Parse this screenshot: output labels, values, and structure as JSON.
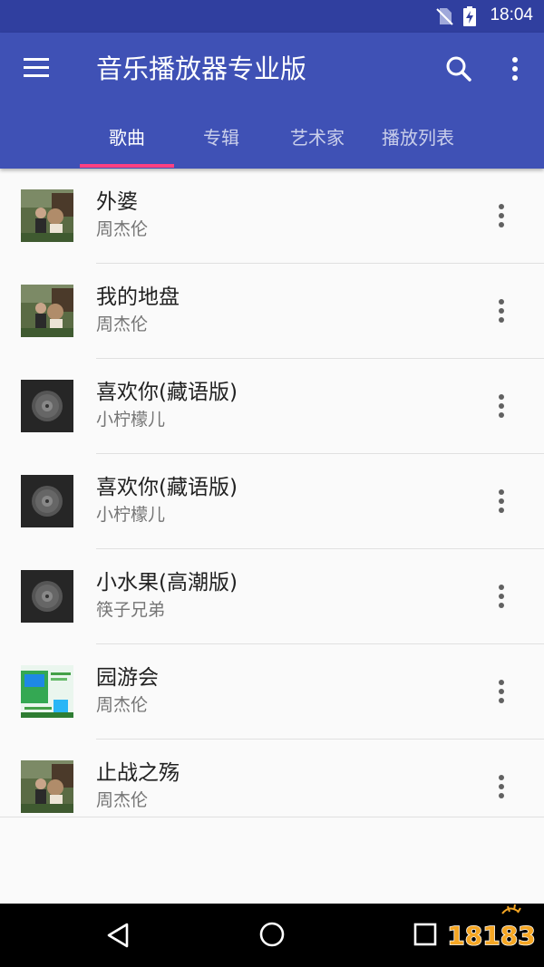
{
  "status_bar": {
    "time": "18:04"
  },
  "app_bar": {
    "title": "音乐播放器专业版"
  },
  "tabs": [
    {
      "label": "歌曲",
      "active": true
    },
    {
      "label": "专辑",
      "active": false
    },
    {
      "label": "艺术家",
      "active": false
    },
    {
      "label": "播放列表",
      "active": false
    }
  ],
  "songs": [
    {
      "title": "外婆",
      "artist": "周杰伦",
      "art": "photo-art"
    },
    {
      "title": "我的地盘",
      "artist": "周杰伦",
      "art": "photo-art"
    },
    {
      "title": "喜欢你(藏语版)",
      "artist": "小柠檬儿",
      "art": "disc-art"
    },
    {
      "title": "喜欢你(藏语版)",
      "artist": "小柠檬儿",
      "art": "disc-art"
    },
    {
      "title": "小水果(高潮版)",
      "artist": "筷子兄弟",
      "art": "disc-art"
    },
    {
      "title": "园游会",
      "artist": "周杰伦",
      "art": "green-art"
    },
    {
      "title": "止战之殇",
      "artist": "周杰伦",
      "art": "photo-art"
    }
  ],
  "colors": {
    "primary": "#3f51b5",
    "primary_dark": "#303f9f",
    "accent": "#ff4081"
  },
  "watermark": {
    "text": "18183"
  }
}
